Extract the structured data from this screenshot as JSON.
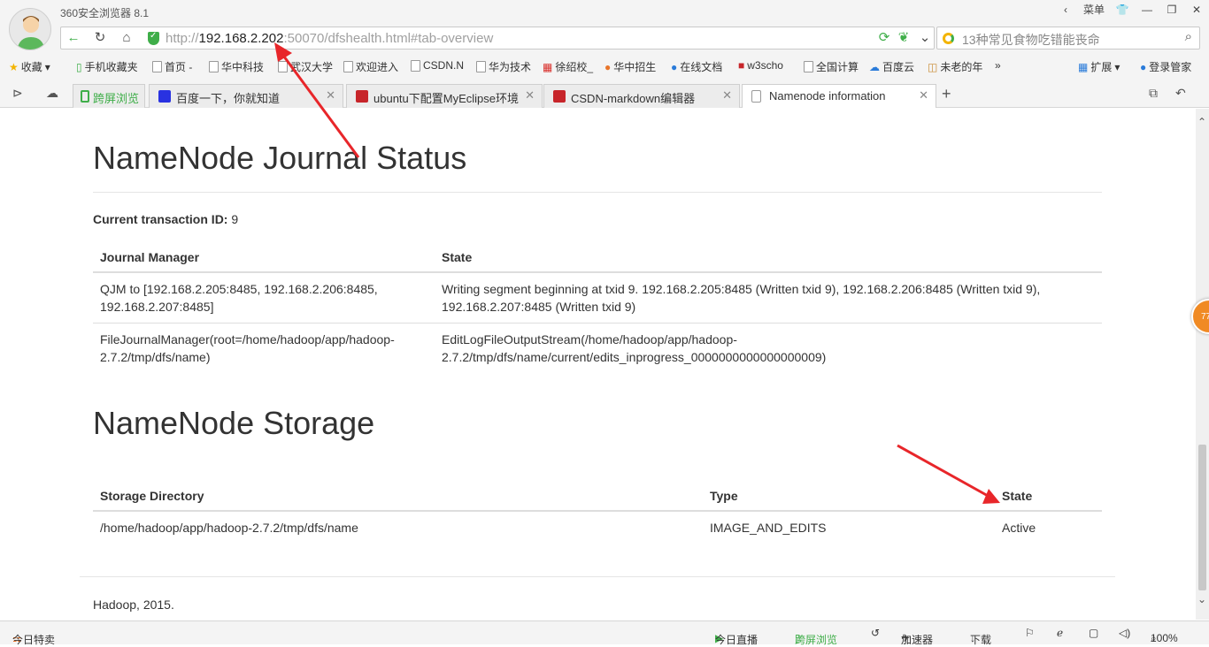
{
  "window": {
    "title": "360安全浏览器 8.1",
    "menu_label": "菜单"
  },
  "address": {
    "scheme": "http://",
    "host": "192.168.2.202",
    "rest": ":50070/dfshealth.html#tab-overview"
  },
  "search": {
    "placeholder": "13种常见食物吃错能丧命"
  },
  "bookmarks": [
    {
      "label": "收藏"
    },
    {
      "label": "手机收藏夹"
    },
    {
      "label": "首页 -"
    },
    {
      "label": "华中科技"
    },
    {
      "label": "武汉大学"
    },
    {
      "label": "欢迎进入"
    },
    {
      "label": "CSDN.N"
    },
    {
      "label": "华为技术"
    },
    {
      "label": "徐绍校_"
    },
    {
      "label": "华中招生"
    },
    {
      "label": "在线文档"
    },
    {
      "label": "w3scho"
    },
    {
      "label": "全国计算"
    },
    {
      "label": "百度云"
    },
    {
      "label": "未老的年"
    },
    {
      "label": "扩展"
    },
    {
      "label": "登录管家"
    }
  ],
  "tabs": [
    {
      "label": "跨屏浏览"
    },
    {
      "label": "百度一下，你就知道"
    },
    {
      "label": "ubuntu下配置MyEclipse环境"
    },
    {
      "label": "CSDN-markdown编辑器"
    },
    {
      "label": "Namenode information"
    }
  ],
  "journal": {
    "title": "NameNode Journal Status",
    "txid_label": "Current transaction ID:",
    "txid_value": "9",
    "headers": [
      "Journal Manager",
      "State"
    ],
    "rows": [
      {
        "manager_l1": "QJM to [192.168.2.205:8485, 192.168.2.206:8485,",
        "manager_l2": "192.168.2.207:8485]",
        "state_l1": "Writing segment beginning at txid 9. 192.168.2.205:8485 (Written txid 9), 192.168.2.206:8485 (Written txid 9),",
        "state_l2": "192.168.2.207:8485 (Written txid 9)"
      },
      {
        "manager_l1": "FileJournalManager(root=/home/hadoop/app/hadoop-",
        "manager_l2": "2.7.2/tmp/dfs/name)",
        "state_l1": "EditLogFileOutputStream(/home/hadoop/app/hadoop-",
        "state_l2": "2.7.2/tmp/dfs/name/current/edits_inprogress_0000000000000000009)"
      }
    ]
  },
  "storage": {
    "title": "NameNode Storage",
    "headers": [
      "Storage Directory",
      "Type",
      "State"
    ],
    "rows": [
      {
        "directory": "/home/hadoop/app/hadoop-2.7.2/tmp/dfs/name",
        "type": "IMAGE_AND_EDITS",
        "state": "Active"
      }
    ]
  },
  "footer": {
    "text": "Hadoop, 2015."
  },
  "statusbar": {
    "left": "今日特卖",
    "live": "今日直播",
    "cross": "跨屏浏览",
    "accel": "加速器",
    "download": "下载",
    "zoom": "100%"
  },
  "badge": {
    "text": "77"
  },
  "colors": {
    "accent_green": "#3fae49",
    "annotation_red": "#e8262a",
    "link_gray": "#a0a0a0"
  }
}
